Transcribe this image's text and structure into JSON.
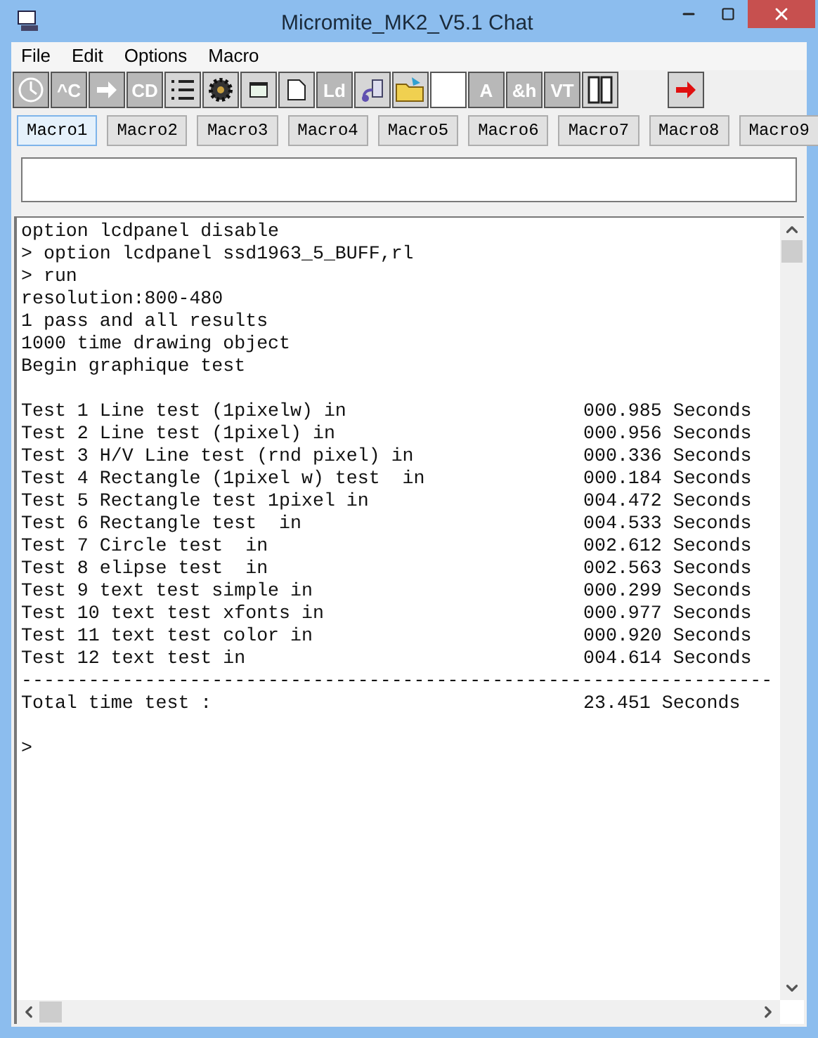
{
  "window": {
    "title": "Micromite_MK2_V5.1 Chat"
  },
  "menu": [
    "File",
    "Edit",
    "Options",
    "Macro"
  ],
  "toolbar": [
    {
      "kind": "clock",
      "disabled": true
    },
    {
      "kind": "text",
      "label": "^C",
      "disabled": true
    },
    {
      "kind": "arrow",
      "disabled": true
    },
    {
      "kind": "text",
      "label": "CD",
      "disabled": true
    },
    {
      "kind": "list",
      "disabled": false
    },
    {
      "kind": "gear",
      "disabled": false
    },
    {
      "kind": "window",
      "disabled": false
    },
    {
      "kind": "page",
      "disabled": false
    },
    {
      "kind": "text",
      "label": "Ld",
      "disabled": true
    },
    {
      "kind": "plug",
      "disabled": false
    },
    {
      "kind": "folder",
      "disabled": false
    },
    {
      "kind": "blank",
      "disabled": false
    },
    {
      "kind": "text",
      "label": "A",
      "disabled": true
    },
    {
      "kind": "text",
      "label": "&h",
      "disabled": true
    },
    {
      "kind": "text",
      "label": "VT",
      "disabled": true
    },
    {
      "kind": "columns",
      "disabled": false
    },
    {
      "kind": "send",
      "disabled": false
    }
  ],
  "macros": [
    {
      "label": "Macro1",
      "selected": true
    },
    {
      "label": "Macro2",
      "selected": false
    },
    {
      "label": "Macro3",
      "selected": false
    },
    {
      "label": "Macro4",
      "selected": false
    },
    {
      "label": "Macro5",
      "selected": false
    },
    {
      "label": "Macro6",
      "selected": false
    },
    {
      "label": "Macro7",
      "selected": false
    },
    {
      "label": "Macro8",
      "selected": false
    },
    {
      "label": "Macro9",
      "selected": false
    }
  ],
  "terminal": {
    "lines": [
      {
        "kind": "text",
        "text": "option lcdpanel disable"
      },
      {
        "kind": "text",
        "text": "> option lcdpanel ssd1963_5_BUFF,rl"
      },
      {
        "kind": "text",
        "text": "> run"
      },
      {
        "kind": "text",
        "text": "resolution:800-480"
      },
      {
        "kind": "text",
        "text": "1 pass and all results"
      },
      {
        "kind": "text",
        "text": "1000 time drawing object"
      },
      {
        "kind": "text",
        "text": "Begin graphique test"
      },
      {
        "kind": "blank"
      },
      {
        "kind": "result",
        "label": "Test 1 Line test (1pixelw) in",
        "value": "000.985 Seconds"
      },
      {
        "kind": "result",
        "label": "Test 2 Line test (1pixel) in",
        "value": "000.956 Seconds"
      },
      {
        "kind": "result",
        "label": "Test 3 H/V Line test (rnd pixel) in",
        "value": "000.336 Seconds"
      },
      {
        "kind": "result",
        "label": "Test 4 Rectangle (1pixel w) test  in",
        "value": "000.184 Seconds"
      },
      {
        "kind": "result",
        "label": "Test 5 Rectangle test 1pixel in",
        "value": "004.472 Seconds"
      },
      {
        "kind": "result",
        "label": "Test 6 Rectangle test  in",
        "value": "004.533 Seconds"
      },
      {
        "kind": "result",
        "label": "Test 7 Circle test  in",
        "value": "002.612 Seconds"
      },
      {
        "kind": "result",
        "label": "Test 8 elipse test  in",
        "value": "002.563 Seconds"
      },
      {
        "kind": "result",
        "label": "Test 9 text test simple in",
        "value": "000.299 Seconds"
      },
      {
        "kind": "result",
        "label": "Test 10 text test xfonts in",
        "value": "000.977 Seconds"
      },
      {
        "kind": "result",
        "label": "Test 11 text test color in",
        "value": "000.920 Seconds"
      },
      {
        "kind": "result",
        "label": "Test 12 text test in",
        "value": "004.614 Seconds"
      },
      {
        "kind": "text",
        "text": "-------------------------------------------------------------------"
      },
      {
        "kind": "result",
        "label": "Total time test :",
        "value": "23.451 Seconds"
      },
      {
        "kind": "blank"
      },
      {
        "kind": "text",
        "text": ">"
      }
    ]
  }
}
